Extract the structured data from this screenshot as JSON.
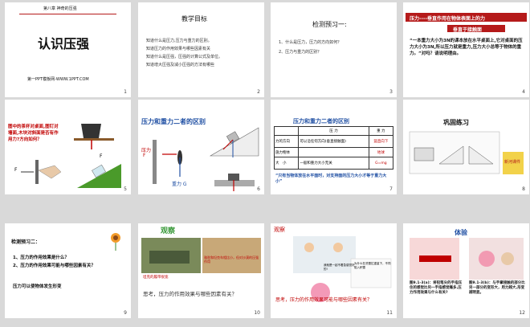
{
  "slides": [
    {
      "num": "1",
      "header": "第八章 神奇的压强",
      "title": "认识压强",
      "footer": "第一PPT模板网-WWW.1PPT.COM"
    },
    {
      "num": "2",
      "title": "教学目标",
      "items": [
        "知道什么是压力,压力与重力的区别。",
        "知道压力的作用效果与哪些因素有关",
        "知道什么是压强，压强的计算公式及单位。",
        "知道增大压强及减小压强的方法有哪些"
      ]
    },
    {
      "num": "3",
      "title": "检测预习一:",
      "items": [
        "1、什么是压力，压力的方向如何？",
        "2、压力与重力的区别？"
      ]
    },
    {
      "num": "4",
      "line1": "压力----垂直作用在物体表面上的力",
      "line2": "垂直于接触面",
      "para": "“一本重力大小为3N的课本放在水平桌面上,它对桌面的压力大小为3N,所以压力就是重力,压力大小总等于物体的重力。”对吗？请说明理由。"
    },
    {
      "num": "5",
      "question": "图中的茶杯对桌面,图钉对墙面,木块对斜面是否有作用力?方向如何？",
      "label_f": "F",
      "label_f2": "F"
    },
    {
      "num": "6",
      "title": "压力和重力二者的区别",
      "label_p": "压力",
      "label_p2": "F",
      "label_g": "重力 G"
    },
    {
      "num": "7",
      "title": "压力和重力二者的区别",
      "table": {
        "headers": [
          "",
          "压 力",
          "重 力"
        ],
        "rows": [
          [
            "力的方向",
            "可以沿任何方向(垂直接触面)",
            "竖直向下"
          ],
          [
            "施力物体",
            "",
            "地球"
          ],
          [
            "大　小",
            "一般和重力大小无关",
            "G=mg"
          ]
        ]
      },
      "note": "“只有当物体放在水平面时，对支持面的压力大小才等于重力大小”"
    },
    {
      "num": "8",
      "title": "巩固练习",
      "side": "新河课件"
    },
    {
      "num": "9",
      "intro": "检测预习二：",
      "items": [
        "1、压力的作用效果是什么？",
        "2、压力的作用效果可能与哪些因素有关？"
      ],
      "answer": "压力可以使物体发生形变"
    },
    {
      "num": "10",
      "title": "观察",
      "cap1": "坦克的履带很宽",
      "cap2": "骆驼和坦克车相比小，但对沙漠的压强作用",
      "question": "思考，压力的作用效果与哪些因素有关？"
    },
    {
      "num": "11",
      "title": "观察",
      "bubble": "我就是一起不着急感觉好的!",
      "cap": "为什么在洗雪拉重量下，不同陷入积雪",
      "q": "思考，压力的作用效果可能与哪些因素有关？"
    },
    {
      "num": "12",
      "title": "体验",
      "d1": "图9.1-3(a)：将铅笔尖的手指压住的感觉比另一手指感觉痛多,压力作用效果与什么有关?",
      "d2": "图9.1-3(b)：与手掌接触的部分比另一部分的变形大，用力越大,形变越明显。"
    }
  ]
}
